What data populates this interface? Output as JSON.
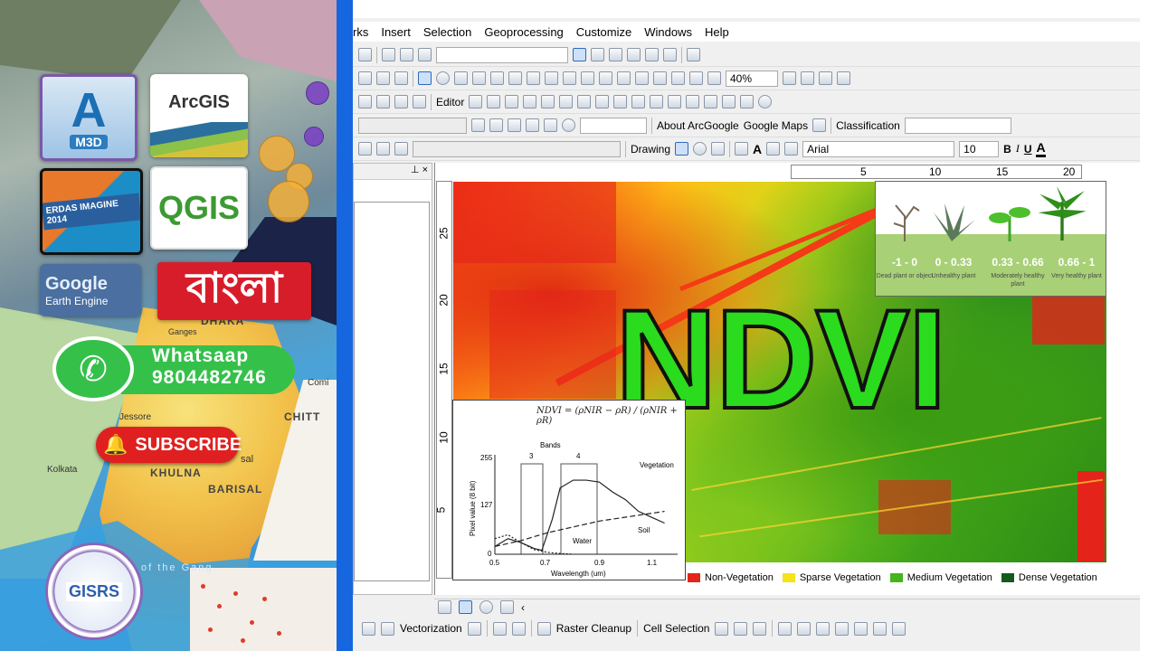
{
  "collage": {
    "logo_m3d": {
      "big": "A",
      "small": "M3D"
    },
    "logo_arcgis": "ArcGIS",
    "logo_erdas": "ERDAS IMAGINE 2014",
    "logo_qgis": "QGIS",
    "logo_gee": {
      "line1": "Google",
      "line2": "Earth Engine"
    },
    "logo_bangla": "বাংলা",
    "whatsapp": {
      "label": "Whatsaap",
      "number": "9804482746"
    },
    "subscribe": "SUBSCRIBE",
    "gisrs": "GISRS",
    "places": [
      "DHAKA",
      "Ganges",
      "Jessore",
      "Comi",
      "CHITT",
      "KHULNA",
      "sal",
      "BARISAL",
      "Kolkata",
      "of the Gang"
    ],
    "colors": {
      "divider": "#1666e0",
      "whatsapp": "#35c04a",
      "subscribe": "#e02020",
      "bangla": "#d81d2a"
    }
  },
  "menubar": [
    "rks",
    "Insert",
    "Selection",
    "Geoprocessing",
    "Customize",
    "Windows",
    "Help"
  ],
  "toolbar2": {
    "zoom": "40%"
  },
  "toolbar3": {
    "editor": "Editor"
  },
  "toolbar4": {
    "about": "About ArcGoogle",
    "google_maps": "Google Maps",
    "classification": "Classification"
  },
  "toolbar5": {
    "drawing": "Drawing",
    "font": "Arial",
    "size": "10",
    "bold": "B",
    "italic": "I",
    "underline": "U",
    "font_color": "A"
  },
  "ruler_top": [
    "5",
    "10",
    "15",
    "20"
  ],
  "ruler_left": [
    "25",
    "20",
    "15",
    "10",
    "5"
  ],
  "ndvi_title": "NDVI",
  "plant_legend": [
    {
      "range": "-1 - 0",
      "desc": "Dead plant or object"
    },
    {
      "range": "0 - 0.33",
      "desc": "Unhealthy plant"
    },
    {
      "range": "0.33 - 0.66",
      "desc": "Moderately healthy plant"
    },
    {
      "range": "0.66 - 1",
      "desc": "Very healthy plant"
    }
  ],
  "spectral_chart": {
    "formula": "NDVI = (ρNIR − ρR) / (ρNIR + ρR)",
    "bands_label": "Bands",
    "band_numbers": [
      "3",
      "4"
    ],
    "ylabel": "Pixel value (8 bit)",
    "xlabel": "Wavelength (um)",
    "yticks": [
      "255",
      "127",
      "0"
    ],
    "xticks": [
      "0.5",
      "0.7",
      "0.9",
      "1.1"
    ],
    "series_labels": {
      "veg": "Vegetation",
      "soil": "Soil",
      "water": "Water"
    }
  },
  "chart_data": {
    "type": "line",
    "xlabel": "Wavelength (um)",
    "ylabel": "Pixel value (8 bit)",
    "xlim": [
      0.5,
      1.2
    ],
    "ylim": [
      0,
      255
    ],
    "series": [
      {
        "name": "Vegetation",
        "x": [
          0.5,
          0.55,
          0.6,
          0.65,
          0.68,
          0.72,
          0.75,
          0.8,
          0.85,
          0.9,
          0.95,
          1.0,
          1.05,
          1.1,
          1.15
        ],
        "y": [
          20,
          40,
          30,
          15,
          10,
          90,
          170,
          190,
          190,
          185,
          160,
          140,
          110,
          95,
          80
        ]
      },
      {
        "name": "Soil",
        "x": [
          0.5,
          0.6,
          0.7,
          0.8,
          0.9,
          1.0,
          1.1,
          1.15
        ],
        "y": [
          20,
          35,
          55,
          70,
          85,
          95,
          105,
          110
        ]
      },
      {
        "name": "Water",
        "x": [
          0.5,
          0.55,
          0.6,
          0.65,
          0.7,
          0.75,
          0.8
        ],
        "y": [
          40,
          50,
          30,
          12,
          5,
          2,
          0
        ]
      }
    ]
  },
  "class_legend": [
    {
      "label": "Non-Vegetation",
      "color": "#e4231a"
    },
    {
      "label": "Sparse Vegetation",
      "color": "#f5e31a"
    },
    {
      "label": "Medium Vegetation",
      "color": "#44b51a"
    },
    {
      "label": "Dense Vegetation",
      "color": "#145a1a"
    }
  ],
  "bottom_toolbar": {
    "vectorization": "Vectorization",
    "raster_cleanup": "Raster Cleanup",
    "cell_selection": "Cell Selection"
  }
}
